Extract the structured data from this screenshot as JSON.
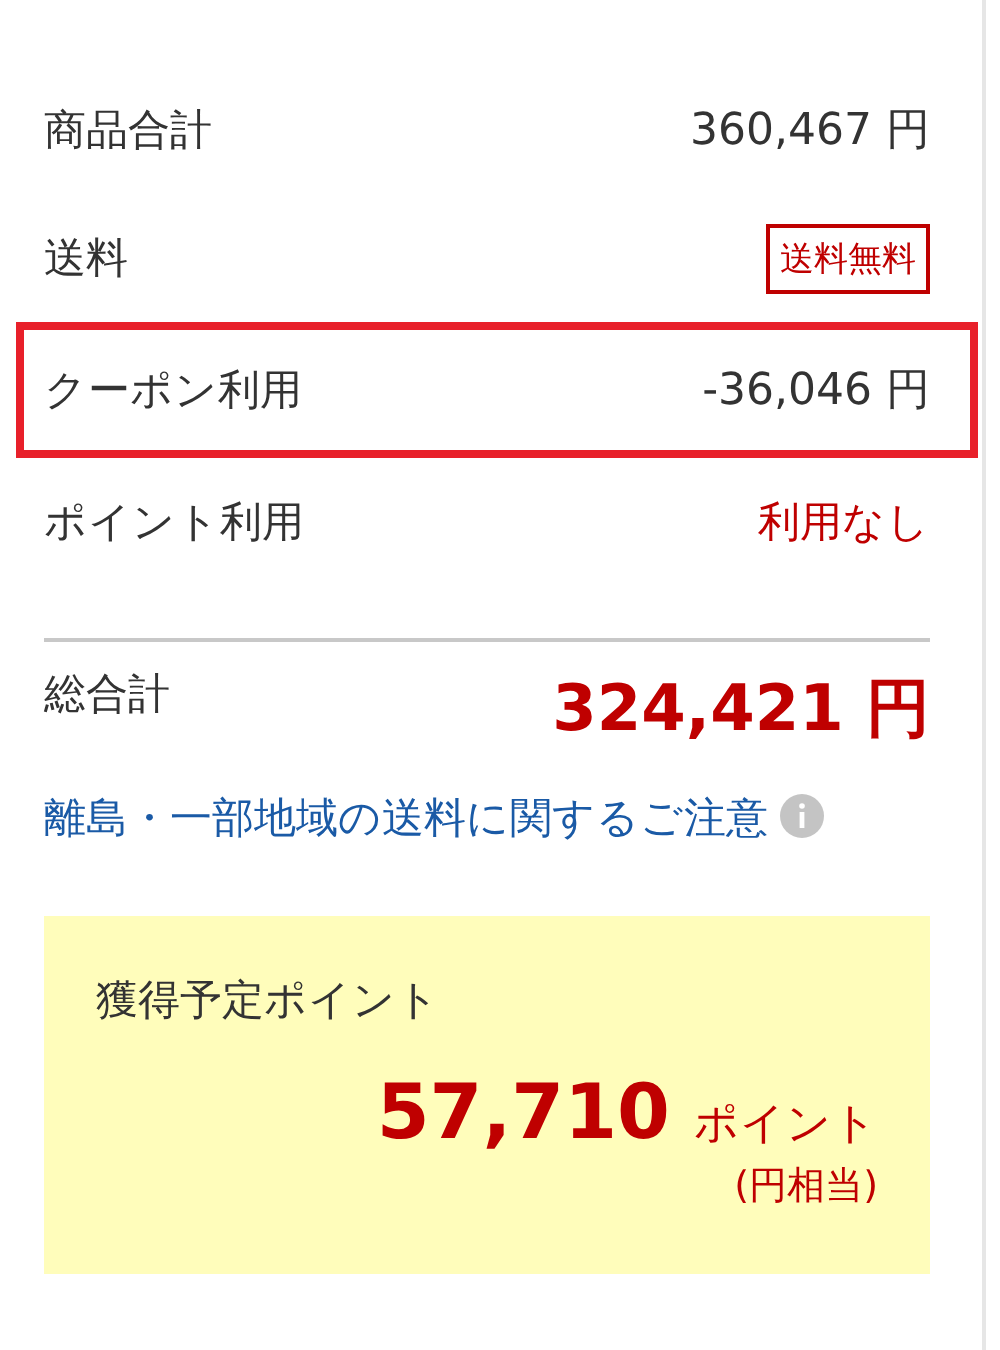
{
  "rows": [
    {
      "label": "商品合計",
      "kind": "amount",
      "value": "360,467 円",
      "highlighted": false
    },
    {
      "label": "送料",
      "kind": "badge",
      "value": "送料無料",
      "highlighted": false
    },
    {
      "label": "クーポン利用",
      "kind": "amount",
      "value": "-36,046 円",
      "highlighted": true
    },
    {
      "label": "ポイント利用",
      "kind": "notice",
      "value": "利用なし",
      "highlighted": false
    }
  ],
  "total": {
    "label": "総合計",
    "value": "324,421 円"
  },
  "shipping_note": {
    "text": "離島・一部地域の送料に関するご注意"
  },
  "points": {
    "title": "獲得予定ポイント",
    "value": "57,710",
    "unit": "ポイント",
    "note": "(円相当)"
  }
}
